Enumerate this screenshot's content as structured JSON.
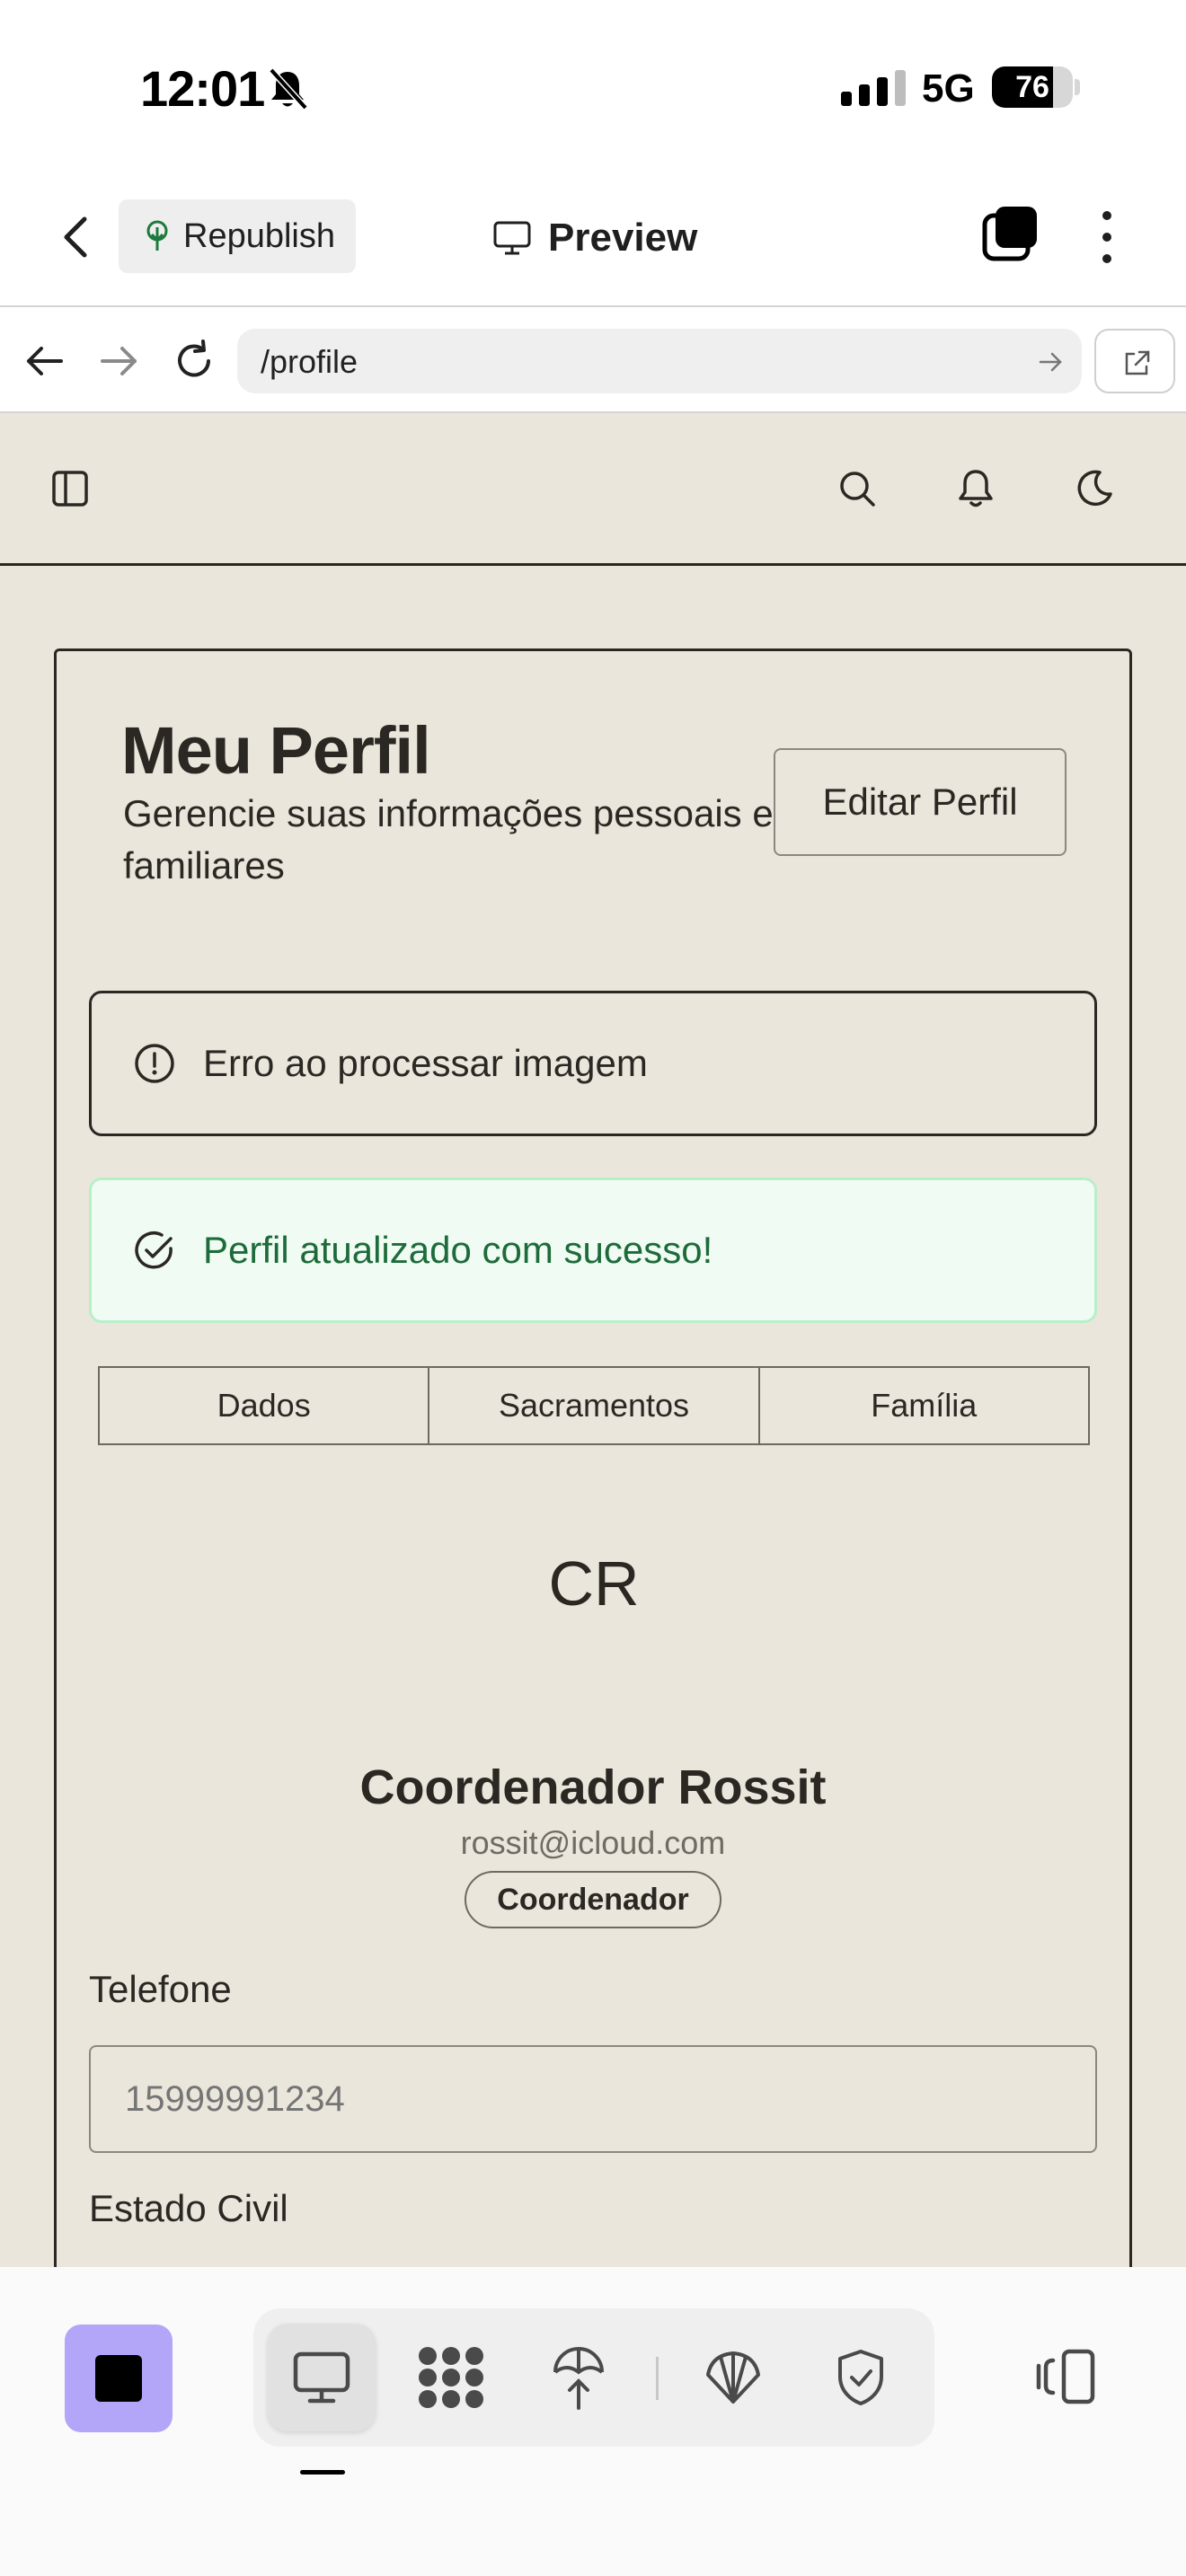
{
  "status_bar": {
    "time": "12:01",
    "network": "5G",
    "battery_percent": 76,
    "battery_label": "76"
  },
  "app_header": {
    "republish_label": "Republish",
    "preview_label": "Preview"
  },
  "browser": {
    "url": "/profile"
  },
  "profile_page": {
    "title": "Meu Perfil",
    "subtitle": "Gerencie suas informações pessoais e familiares",
    "edit_button": "Editar Perfil",
    "error_message": "Erro ao processar imagem",
    "success_message": "Perfil atualizado com sucesso!",
    "tabs": [
      {
        "label": "Dados"
      },
      {
        "label": "Sacramentos"
      },
      {
        "label": "Família"
      }
    ],
    "avatar_initials": "CR",
    "user_name": "Coordenador Rossit",
    "user_email": "rossit@icloud.com",
    "role_badge": "Coordenador",
    "phone_label": "Telefone",
    "phone_placeholder": "15999991234",
    "civil_status_label": "Estado Civil"
  },
  "colors": {
    "page_background": "#ebe6db",
    "ink": "#2b2824",
    "success_text": "#1d6b3a",
    "success_background": "#f0fcf3",
    "stop_button": "#b3a5f7"
  },
  "icons": {
    "header": [
      "chevron-left-icon",
      "tree-icon",
      "monitor-icon",
      "tabs-icon",
      "more-vertical-icon"
    ],
    "browser": [
      "arrow-left-icon",
      "arrow-right-icon",
      "reload-icon",
      "arrow-right-icon",
      "external-link-icon"
    ],
    "web_topbar": [
      "sidebar-toggle-icon",
      "search-icon",
      "bell-icon",
      "moon-icon"
    ],
    "toolbar": [
      "stop-icon",
      "monitor-icon",
      "dots-grid-icon",
      "deploy-icon",
      "shell-icon",
      "shield-check-icon",
      "panel-toggle-icon"
    ]
  }
}
